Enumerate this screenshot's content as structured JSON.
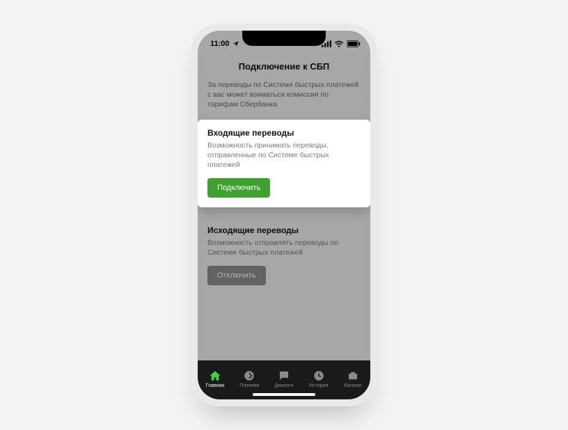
{
  "status": {
    "time": "11:00"
  },
  "page": {
    "title": "Подключение к СБП",
    "note": "За переводы по Системе быстрых платежей с вас может взиматься комиссия по тарифам Сбербанка"
  },
  "cards": {
    "incoming": {
      "title": "Входящие переводы",
      "desc": "Возможность принимать переводы, отправленные по Системе быстрых платежей",
      "button": "Подключить"
    },
    "outgoing": {
      "title": "Исходящие переводы",
      "desc": "Возможность отправлять переводы по Системе быстрых платежей",
      "button": "Отключить"
    }
  },
  "tabs": {
    "home": "Главная",
    "payments": "Платежи",
    "dialogs": "Диалоги",
    "history": "История",
    "catalog": "Каталог"
  }
}
